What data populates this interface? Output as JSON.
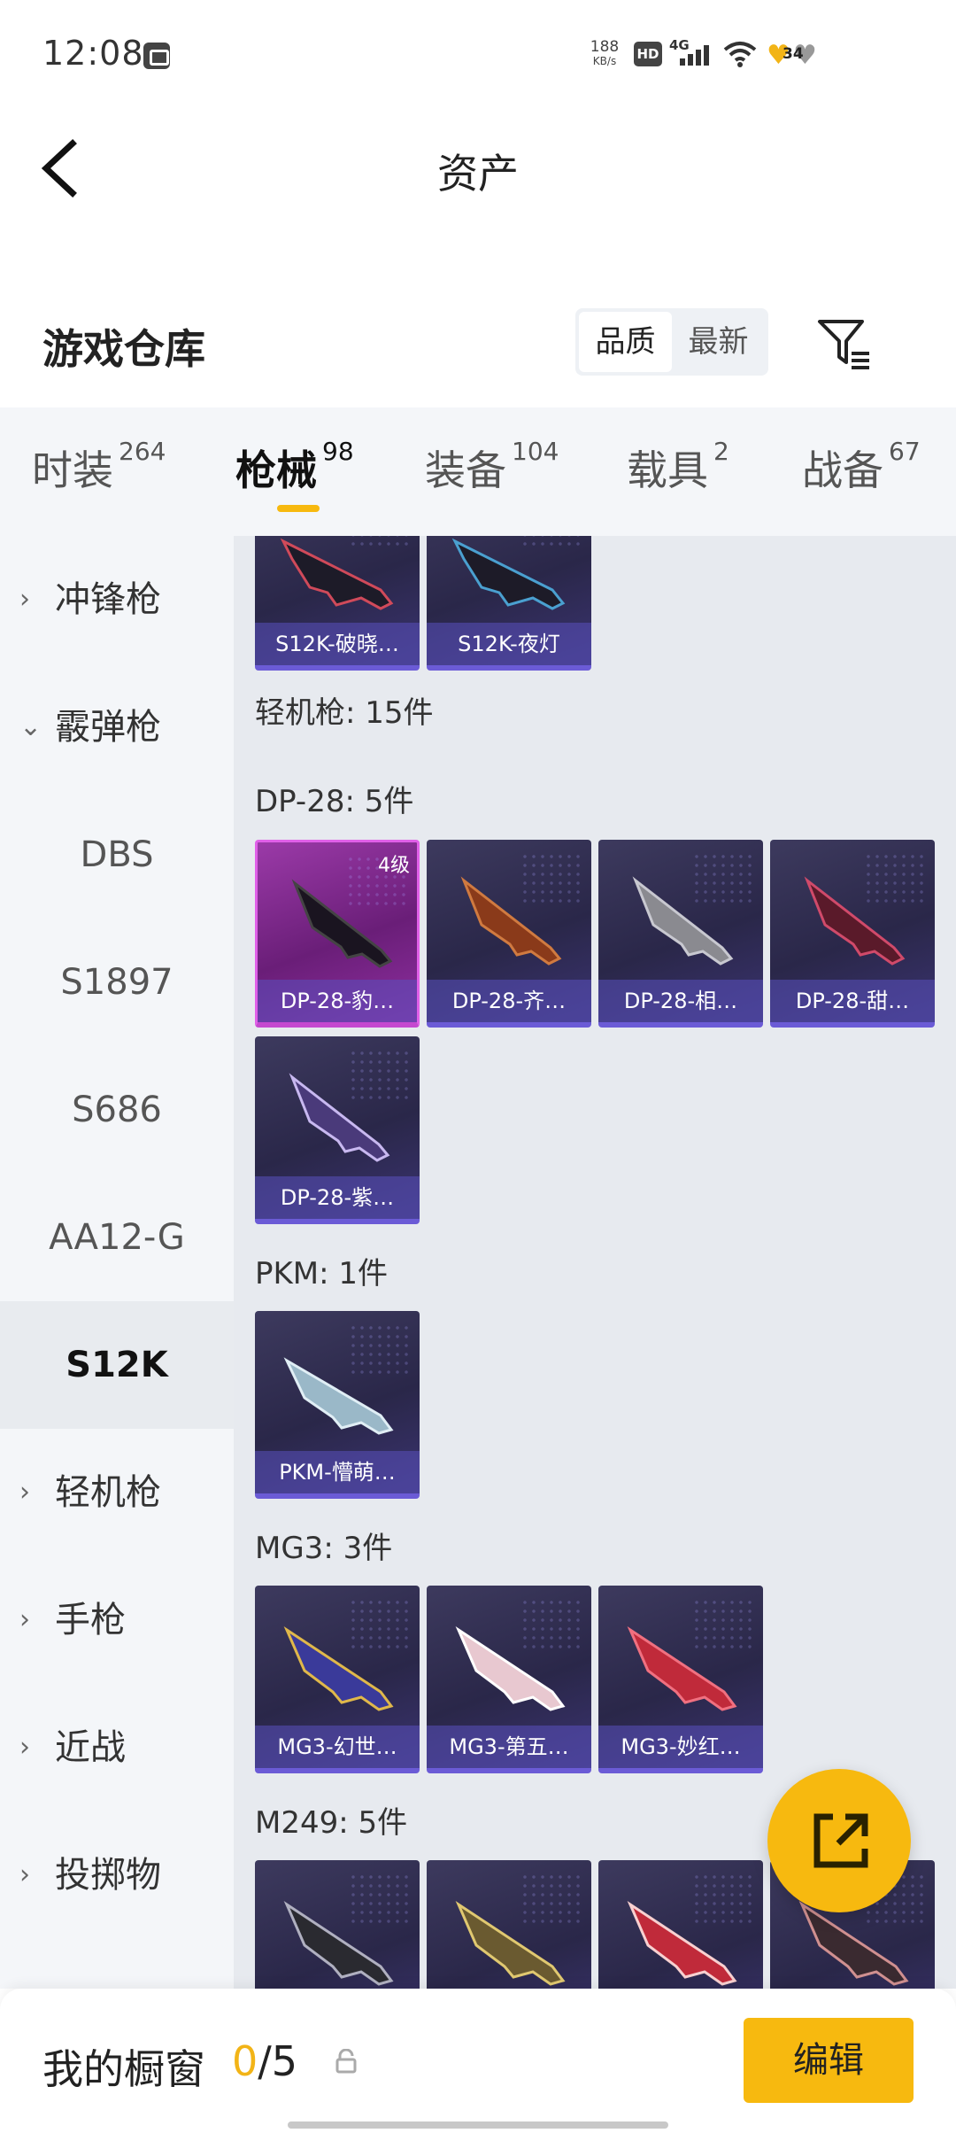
{
  "status_bar": {
    "time": "12:08",
    "net_speed_value": "188",
    "net_speed_unit": "KB/s",
    "hd": "HD",
    "network": "4G",
    "battery_level": "34"
  },
  "header": {
    "title": "资产"
  },
  "warehouse": {
    "title": "游戏仓库",
    "sort_options": [
      "品质",
      "最新"
    ],
    "active_sort": "品质"
  },
  "tabs": [
    {
      "label": "时装",
      "count": "264"
    },
    {
      "label": "枪械",
      "count": "98"
    },
    {
      "label": "装备",
      "count": "104"
    },
    {
      "label": "载具",
      "count": "2"
    },
    {
      "label": "战备",
      "count": "67"
    }
  ],
  "active_tab": "枪械",
  "sidebar": {
    "items": [
      {
        "label": "冲锋枪",
        "type": "group",
        "expanded": false
      },
      {
        "label": "霰弹枪",
        "type": "group",
        "expanded": true
      },
      {
        "label": "DBS",
        "type": "sub"
      },
      {
        "label": "S1897",
        "type": "sub"
      },
      {
        "label": "S686",
        "type": "sub"
      },
      {
        "label": "AA12-G",
        "type": "sub"
      },
      {
        "label": "S12K",
        "type": "sub",
        "selected": true
      },
      {
        "label": "轻机枪",
        "type": "group",
        "expanded": false
      },
      {
        "label": "手枪",
        "type": "group",
        "expanded": false
      },
      {
        "label": "近战",
        "type": "group",
        "expanded": false
      },
      {
        "label": "投掷物",
        "type": "group",
        "expanded": false
      }
    ]
  },
  "content": {
    "top_cards": [
      {
        "name": "S12K-破晓…"
      },
      {
        "name": "S12K-夜灯"
      }
    ],
    "category_header": "轻机枪: 15件",
    "groups": [
      {
        "label": "DP-28: 5件",
        "cards": [
          {
            "name": "DP-28-豹…",
            "level": "4级",
            "rarity": "gold"
          },
          {
            "name": "DP-28-齐…"
          },
          {
            "name": "DP-28-相…"
          },
          {
            "name": "DP-28-甜…"
          },
          {
            "name": "DP-28-紫…"
          }
        ]
      },
      {
        "label": "PKM: 1件",
        "cards": [
          {
            "name": "PKM-懵萌…"
          }
        ]
      },
      {
        "label": "MG3: 3件",
        "cards": [
          {
            "name": "MG3-幻世…"
          },
          {
            "name": "MG3-第五…"
          },
          {
            "name": "MG3-妙红…"
          }
        ]
      },
      {
        "label": "M249: 5件",
        "cards": [
          {
            "name": ""
          },
          {
            "name": ""
          },
          {
            "name": ""
          },
          {
            "name": ""
          }
        ]
      }
    ]
  },
  "bottom_bar": {
    "showcase_label": "我的橱窗",
    "showcase_current": "0",
    "showcase_sep": "/",
    "showcase_max": "5",
    "edit_label": "编辑"
  },
  "colors": {
    "accent": "#f7b90f",
    "card_border": "#6b5bd6",
    "gold_card": "#9b3aa8"
  }
}
